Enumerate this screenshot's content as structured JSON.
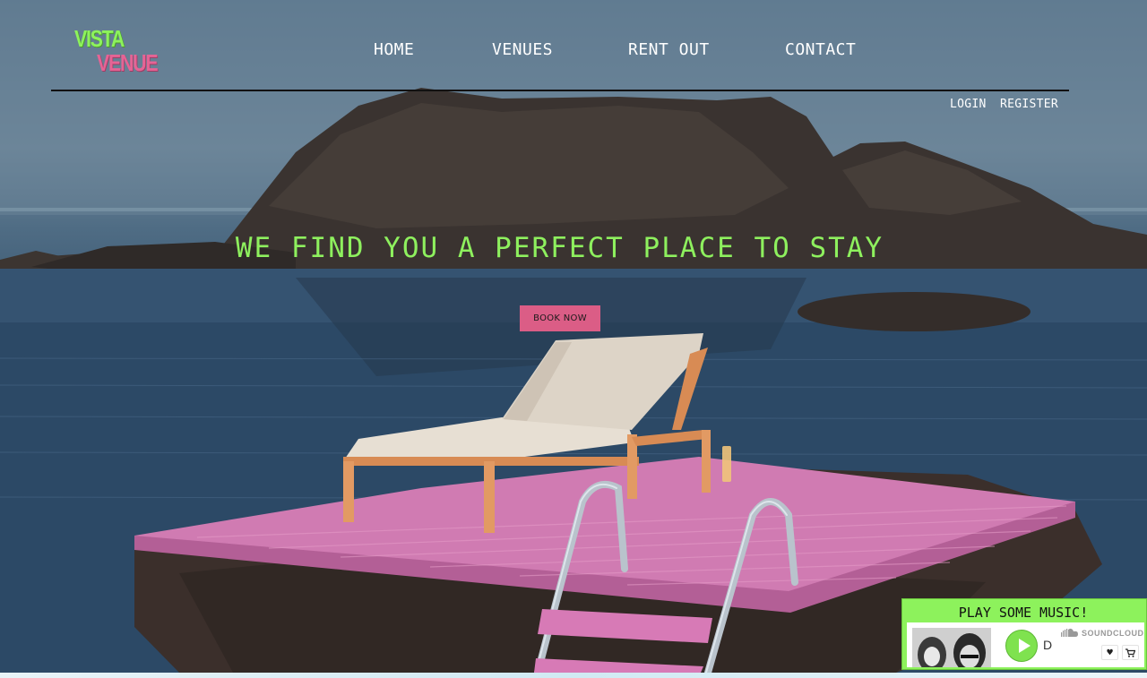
{
  "brand": {
    "line1": "VISTA",
    "line2": "VENUE"
  },
  "nav": {
    "items": [
      {
        "label": "HOME"
      },
      {
        "label": "VENUES"
      },
      {
        "label": "RENT OUT"
      },
      {
        "label": "CONTACT"
      }
    ]
  },
  "auth": {
    "login": "LOGIN",
    "register": "REGISTER"
  },
  "hero": {
    "headline": "WE FIND YOU A PERFECT PLACE TO STAY",
    "cta": "BOOK NOW"
  },
  "music": {
    "title": "PLAY SOME MUSIC!",
    "player": {
      "brand": "SOUNDCLOUD",
      "track": "D",
      "icons": [
        "play-icon",
        "soundcloud-icon",
        "heart-icon",
        "cart-icon"
      ]
    }
  },
  "colors": {
    "accent_green": "#8df25c",
    "accent_pink": "#db5d86",
    "nav_text": "#ffffff"
  }
}
